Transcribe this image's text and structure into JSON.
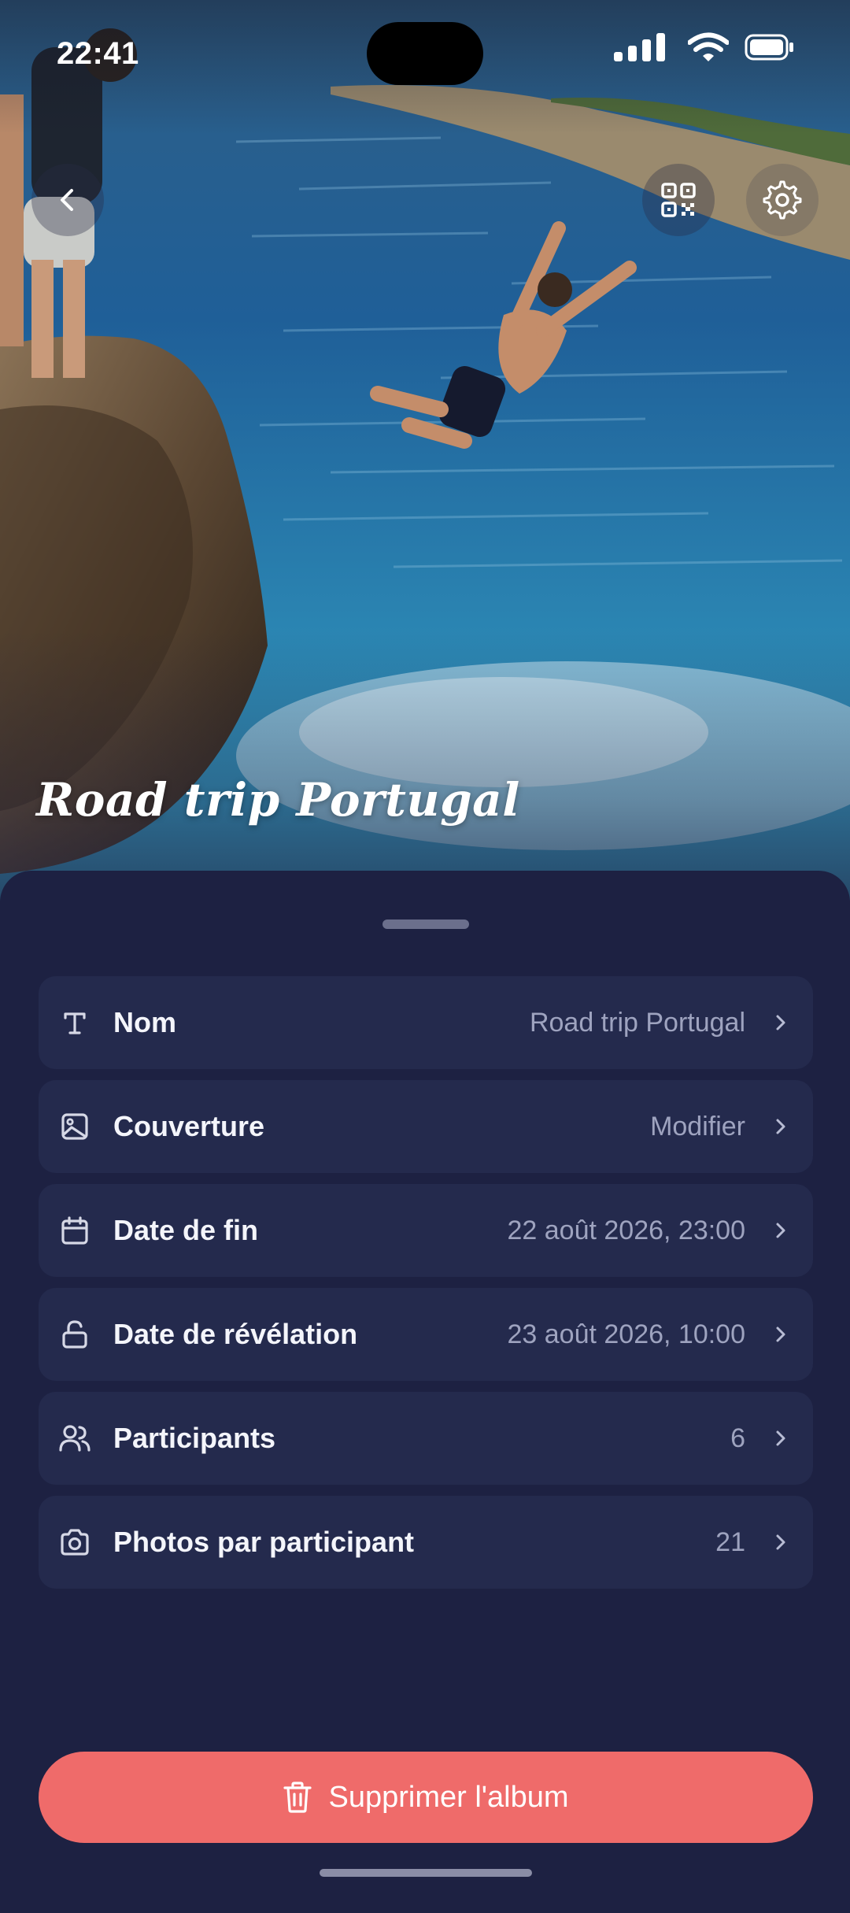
{
  "status_bar": {
    "time": "22:41"
  },
  "hero": {
    "album_title": "Road trip Portugal"
  },
  "settings": [
    {
      "icon": "text-icon",
      "label": "Nom",
      "value": "Road trip Portugal"
    },
    {
      "icon": "image-icon",
      "label": "Couverture",
      "value": "Modifier"
    },
    {
      "icon": "calendar-icon",
      "label": "Date de fin",
      "value": "22 août 2026, 23:00"
    },
    {
      "icon": "unlock-icon",
      "label": "Date de révélation",
      "value": "23 août 2026, 10:00"
    },
    {
      "icon": "users-icon",
      "label": "Participants",
      "value": "6"
    },
    {
      "icon": "camera-icon",
      "label": "Photos par participant",
      "value": "21"
    }
  ],
  "delete_button": {
    "label": "Supprimer l'album",
    "icon": "trash-icon"
  },
  "colors": {
    "background": "#1d2142",
    "row": "#242a4d",
    "delete": "#ef6b6a"
  }
}
